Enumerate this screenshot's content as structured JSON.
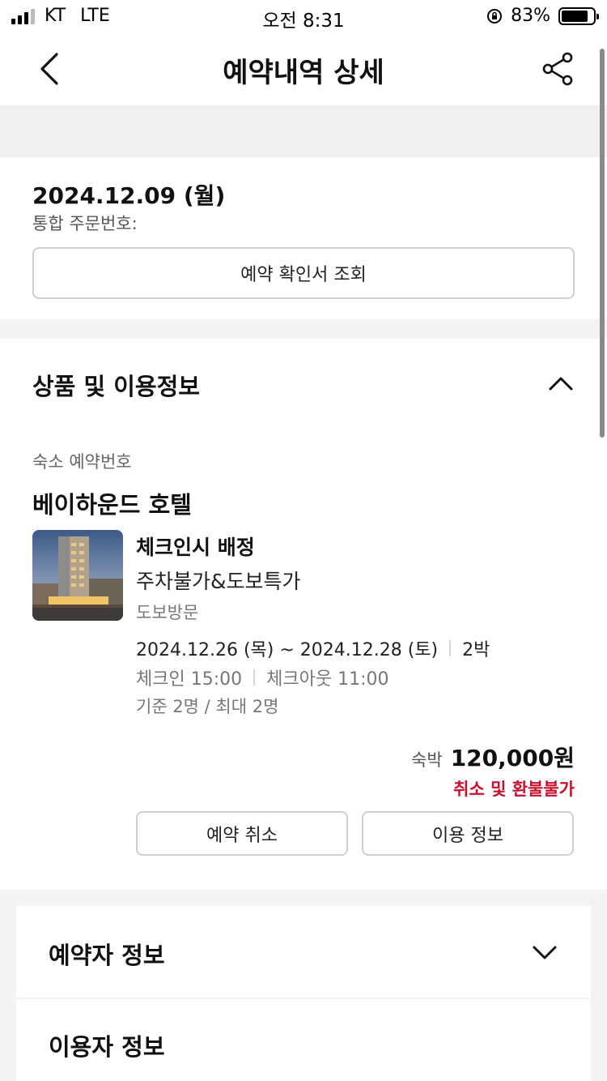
{
  "status_bar": {
    "carrier": "KT",
    "network": "LTE",
    "time": "오전 8:31",
    "battery_percent": "83%",
    "battery_level": 0.83,
    "signal_bars": 3
  },
  "header": {
    "title": "예약내역 상세",
    "back_icon": "chevron-left-icon",
    "share_icon": "share-icon"
  },
  "order": {
    "date": "2024.12.09 (월)",
    "order_number_label": "통합 주문번호:",
    "confirm_button": "예약 확인서 조회"
  },
  "product": {
    "section_title": "상품 및 이용정보",
    "reservation_label": "숙소 예약번호",
    "hotel_name": "베이하운드 호텔",
    "room_name": "체크인시 배정",
    "plan_name": "주차불가&도보특가",
    "visit_type": "도보방문",
    "dates": "2024.12.26 (목) ~ 2024.12.28 (토)",
    "nights": "2박",
    "checkin": "체크인 15:00",
    "checkout": "체크아웃 11:00",
    "guests": "기준 2명 / 최대 2명",
    "price_label": "숙박",
    "price": "120,000원",
    "refund_policy": "취소 및 환불불가",
    "cancel_button": "예약 취소",
    "info_button": "이용 정보"
  },
  "sections": {
    "booker_title": "예약자 정보",
    "user_title": "이용자 정보"
  },
  "colors": {
    "accent_red": "#c8102e",
    "separator": "#f3f3f3"
  }
}
